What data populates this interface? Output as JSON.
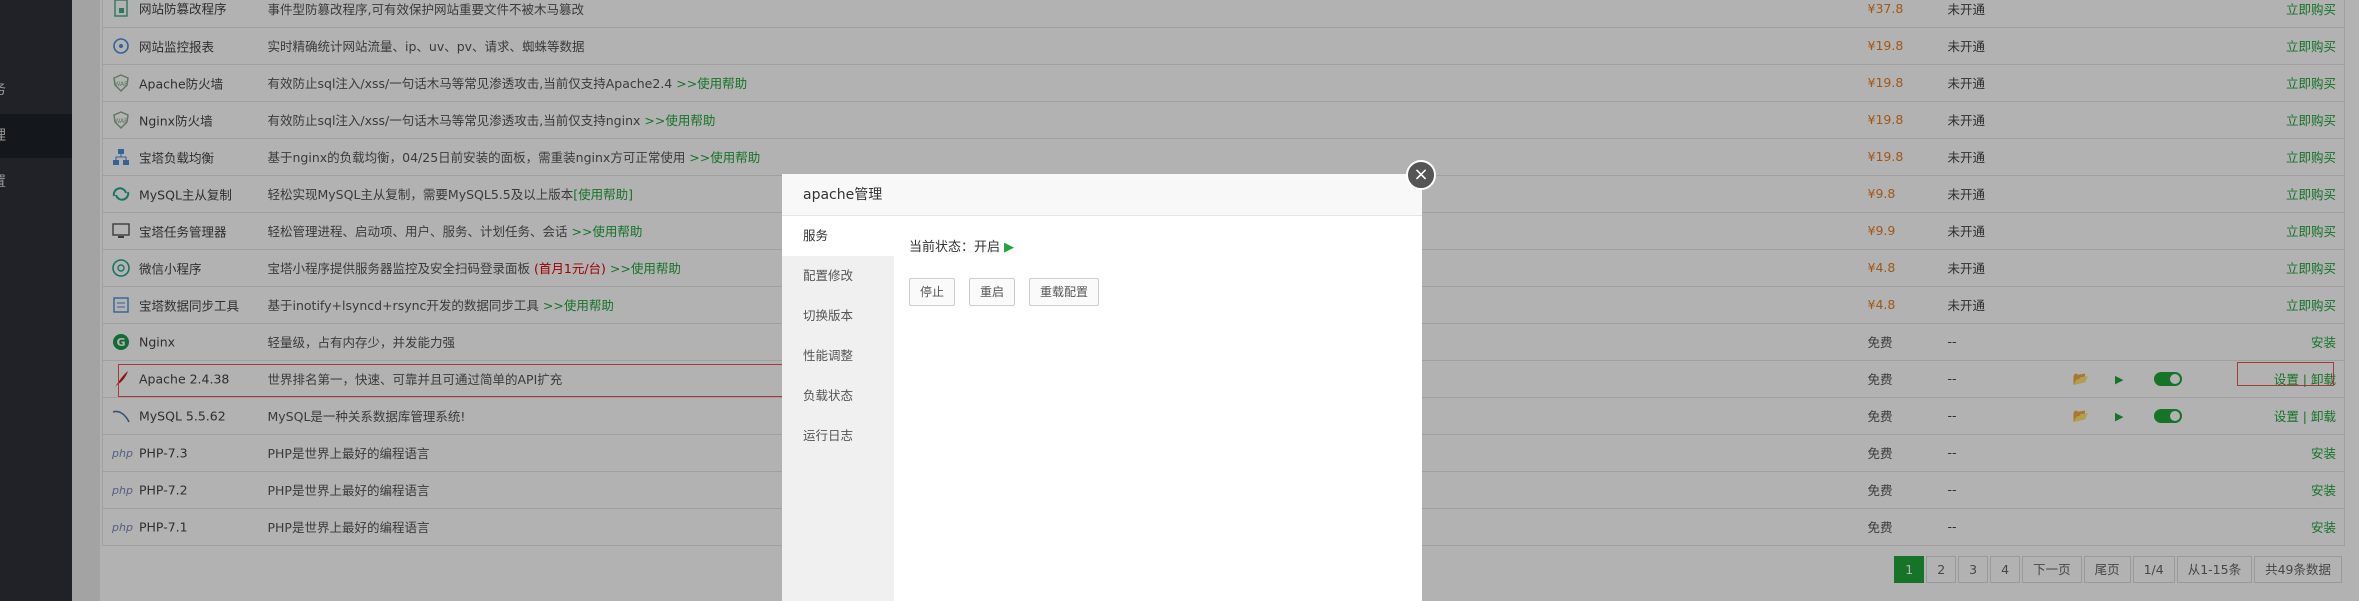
{
  "sidebar": {
    "items": [
      {
        "label": "务"
      },
      {
        "label": "理"
      },
      {
        "label": "置"
      }
    ]
  },
  "plugins": [
    {
      "name": "网站防篡改程序",
      "icon": "lock-file-icon",
      "desc": "事件型防篡改程序,可有效保护网站重要文件不被木马篡改",
      "help": "",
      "desc_red": "",
      "desc_after": "",
      "price": "¥37.8",
      "status": "未开通",
      "action": "立即购买"
    },
    {
      "name": "网站监控报表",
      "icon": "monitor-report-icon",
      "desc": "实时精确统计网站流量、ip、uv、pv、请求、蜘蛛等数据",
      "help": "",
      "desc_red": "",
      "desc_after": "",
      "price": "¥19.8",
      "status": "未开通",
      "action": "立即购买"
    },
    {
      "name": "Apache防火墙",
      "icon": "waf-shield-icon",
      "desc": "有效防止sql注入/xss/一句话木马等常见渗透攻击,当前仅支持Apache2.4 ",
      "help": ">>使用帮助",
      "desc_red": "",
      "desc_after": "",
      "price": "¥19.8",
      "status": "未开通",
      "action": "立即购买"
    },
    {
      "name": "Nginx防火墙",
      "icon": "waf-shield-icon",
      "desc": "有效防止sql注入/xss/一句话木马等常见渗透攻击,当前仅支持nginx ",
      "help": ">>使用帮助",
      "desc_red": "",
      "desc_after": "",
      "price": "¥19.8",
      "status": "未开通",
      "action": "立即购买"
    },
    {
      "name": "宝塔负载均衡",
      "icon": "load-balance-icon",
      "desc": "基于nginx的负载均衡，04/25日前安装的面板，需重装nginx方可正常使用 ",
      "help": ">>使用帮助",
      "desc_red": "",
      "desc_after": "",
      "price": "¥19.8",
      "status": "未开通",
      "action": "立即购买"
    },
    {
      "name": "MySQL主从复制",
      "icon": "replication-icon",
      "desc": "轻松实现MySQL主从复制，需要MySQL5.5及以上版本",
      "help": "[使用帮助]",
      "desc_red": "",
      "desc_after": "",
      "price": "¥9.8",
      "status": "未开通",
      "action": "立即购买"
    },
    {
      "name": "宝塔任务管理器",
      "icon": "task-manager-icon",
      "desc": "轻松管理进程、启动项、用户、服务、计划任务、会话 ",
      "help": ">>使用帮助",
      "desc_red": "",
      "desc_after": "",
      "price": "¥9.9",
      "status": "未开通",
      "action": "立即购买"
    },
    {
      "name": "微信小程序",
      "icon": "wechat-mini-icon",
      "desc": "宝塔小程序提供服务器监控及安全扫码登录面板 ",
      "help": ">>使用帮助",
      "desc_red": "(首月1元/台)",
      "desc_after": " ",
      "price": "¥4.8",
      "status": "未开通",
      "action": "立即购买"
    },
    {
      "name": "宝塔数据同步工具",
      "icon": "data-sync-icon",
      "desc": "基于inotify+lsyncd+rsync开发的数据同步工具 ",
      "help": ">>使用帮助",
      "desc_red": "",
      "desc_after": "",
      "price": "¥4.8",
      "status": "未开通",
      "action": "立即购买"
    },
    {
      "name": "Nginx",
      "icon": "nginx-icon",
      "desc": "轻量级，占有内存少，并发能力强",
      "help": "",
      "desc_red": "",
      "desc_after": "",
      "price": "免费",
      "status": "--",
      "action": "安装"
    },
    {
      "name": "Apache 2.4.38",
      "icon": "apache-feather-icon",
      "desc": "世界排名第一，快速、可靠并且可通过简单的API扩充",
      "help": "",
      "desc_red": "",
      "desc_after": "",
      "price": "免费",
      "status": "--",
      "action": "设置 | 卸载",
      "installed": true
    },
    {
      "name": "MySQL 5.5.62",
      "icon": "mysql-dolphin-icon",
      "desc": "MySQL是一种关系数据库管理系统!",
      "help": "",
      "desc_red": "",
      "desc_after": "",
      "price": "免费",
      "status": "--",
      "action": "设置 | 卸载",
      "installed": true
    },
    {
      "name": "PHP-7.3",
      "icon": "php-icon",
      "desc": "PHP是世界上最好的编程语言",
      "help": "",
      "desc_red": "",
      "desc_after": "",
      "price": "免费",
      "status": "--",
      "action": "安装"
    },
    {
      "name": "PHP-7.2",
      "icon": "php-icon",
      "desc": "PHP是世界上最好的编程语言",
      "help": "",
      "desc_red": "",
      "desc_after": "",
      "price": "免费",
      "status": "--",
      "action": "安装"
    },
    {
      "name": "PHP-7.1",
      "icon": "php-icon",
      "desc": "PHP是世界上最好的编程语言",
      "help": "",
      "desc_red": "",
      "desc_after": "",
      "price": "免费",
      "status": "--",
      "action": "安装"
    }
  ],
  "pagination": {
    "pages": [
      "1",
      "2",
      "3",
      "4"
    ],
    "next": "下一页",
    "last": "尾页",
    "page_info": "1/4",
    "range": "从1-15条",
    "total": "共49条数据"
  },
  "modal": {
    "title": "apache管理",
    "close": "×",
    "nav": [
      "服务",
      "配置修改",
      "切换版本",
      "性能调整",
      "负载状态",
      "运行日志"
    ],
    "status_label": "当前状态：开启",
    "buttons": {
      "stop": "停止",
      "restart": "重启",
      "reload": "重载配置"
    }
  },
  "colors": {
    "accent": "#20a53a",
    "price": "#e67e22",
    "sidebar": "#2f323a"
  }
}
